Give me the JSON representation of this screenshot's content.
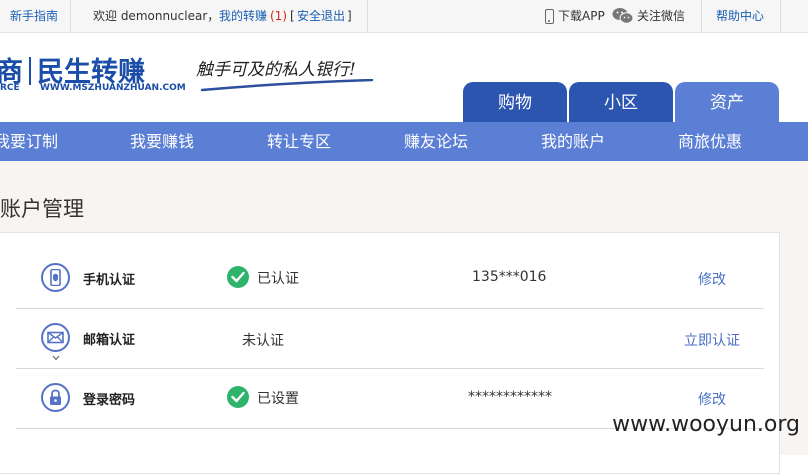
{
  "topbar": {
    "guide": "新手指南",
    "welcome": "欢迎 demonnuclear，",
    "my_zz": "我的转赚",
    "count": "(1)",
    "logout_open": "[",
    "logout": "安全退出",
    "logout_close": "]",
    "download_app": "下载APP",
    "follow_wechat": "关注微信",
    "help": "帮助中心"
  },
  "logo": {
    "cn_left": "商",
    "cn_main": "民生转赚",
    "en_left": "RCE",
    "en_main": "WWW.MSZHUANZHUAN.COM",
    "slogan": "触手可及的私人银行!"
  },
  "tabs": [
    "购物",
    "小区",
    "资产"
  ],
  "nav": [
    "我要订制",
    "我要赚钱",
    "转让专区",
    "赚友论坛",
    "我的账户",
    "商旅优惠"
  ],
  "page_title": "账户管理",
  "rows": [
    {
      "label": "手机认证",
      "status": "已认证",
      "value": "135***016",
      "action": "修改",
      "icon": "phone-icon"
    },
    {
      "label": "邮箱认证",
      "status": "未认证",
      "value": "",
      "action": "立即认证",
      "icon": "mail-icon"
    },
    {
      "label": "登录密码",
      "status": "已设置",
      "value": "************",
      "action": "修改",
      "icon": "lock-icon"
    }
  ],
  "watermark": "www.wooyun.org",
  "colors": {
    "nav_bg": "#5b7fd4",
    "tab_dark": "#2c55b0",
    "brand": "#1a4ea8",
    "check": "#2eb36a",
    "action": "#4a6fc4"
  }
}
